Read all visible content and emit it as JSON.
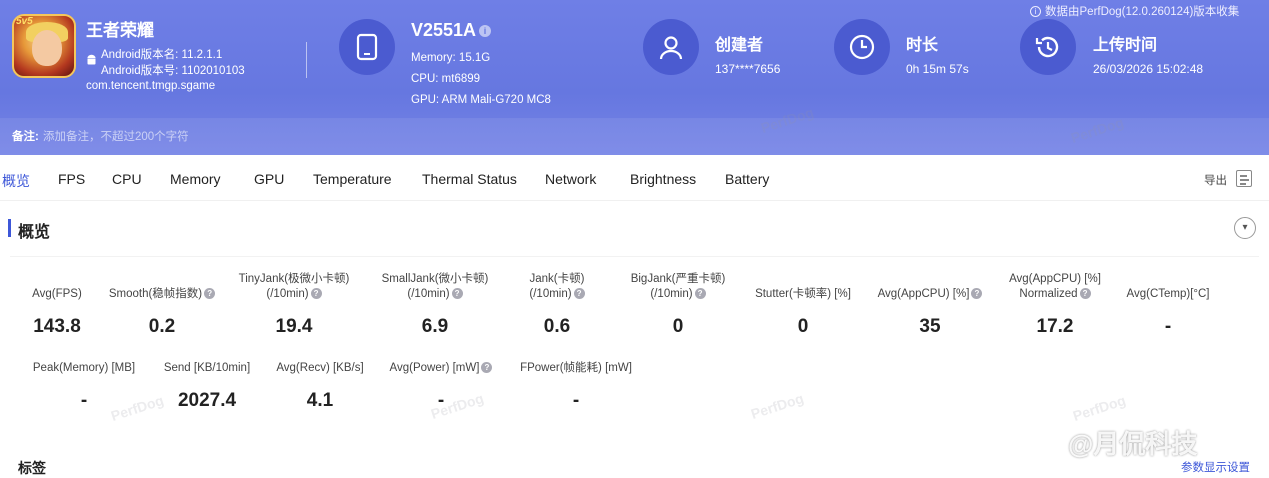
{
  "header": {
    "app_name": "王者荣耀",
    "app_icon_badge": "5v5",
    "version_name": "Android版本名: 11.2.1.1",
    "version_code": "Android版本号: 1102010103",
    "package": "com.tencent.tmgp.sgame",
    "device": {
      "name": "V2551A",
      "memory": "Memory: 15.1G",
      "cpu": "CPU: mt6899",
      "gpu": "GPU: ARM Mali-G720 MC8"
    },
    "creator": {
      "title": "创建者",
      "value": "137****7656"
    },
    "duration": {
      "title": "时长",
      "value": "0h 15m 57s"
    },
    "upload": {
      "title": "上传时间",
      "value": "26/03/2026 15:02:48"
    },
    "source_note": "数据由PerfDog(12.0.260124)版本收集",
    "note_label": "备注:",
    "note_placeholder": "添加备注，不超过200个字符"
  },
  "tabs": [
    "概览",
    "FPS",
    "CPU",
    "Memory",
    "GPU",
    "Temperature",
    "Thermal Status",
    "Network",
    "Brightness",
    "Battery"
  ],
  "export_label": "导出",
  "section_title": "概览",
  "metrics_row1": [
    {
      "l1": "",
      "l2": "Avg(FPS)",
      "q": false,
      "value": "143.8"
    },
    {
      "l1": "",
      "l2": "Smooth(稳帧指数)",
      "q": true,
      "value": "0.2"
    },
    {
      "l1": "TinyJank(极微小卡顿)",
      "l2": "(/10min)",
      "q": true,
      "value": "19.4"
    },
    {
      "l1": "SmallJank(微小卡顿)",
      "l2": "(/10min)",
      "q": true,
      "value": "6.9"
    },
    {
      "l1": "Jank(卡顿)",
      "l2": "(/10min)",
      "q": true,
      "value": "0.6"
    },
    {
      "l1": "BigJank(严重卡顿)",
      "l2": "(/10min)",
      "q": true,
      "value": "0"
    },
    {
      "l1": "",
      "l2": "Stutter(卡顿率) [%]",
      "q": false,
      "value": "0"
    },
    {
      "l1": "",
      "l2": "Avg(AppCPU) [%]",
      "q": true,
      "value": "35"
    },
    {
      "l1": "Avg(AppCPU) [%]",
      "l2": "Normalized",
      "q": true,
      "value": "17.2"
    },
    {
      "l1": "",
      "l2": "Avg(CTemp)[°C]",
      "q": false,
      "value": "-"
    }
  ],
  "metrics_row2": [
    {
      "l2": "Peak(Memory) [MB]",
      "q": false,
      "value": "-"
    },
    {
      "l2": "Send [KB/10min]",
      "q": false,
      "value": "2027.4"
    },
    {
      "l2": "Avg(Recv) [KB/s]",
      "q": false,
      "value": "4.1"
    },
    {
      "l2": "Avg(Power) [mW]",
      "q": true,
      "value": "-"
    },
    {
      "l2": "FPower(帧能耗) [mW]",
      "q": false,
      "value": "-"
    }
  ],
  "tags_title": "标签",
  "param_link": "参数显示设置",
  "watermark_text": "PerfDog",
  "weibo_text": "@月侃科技"
}
